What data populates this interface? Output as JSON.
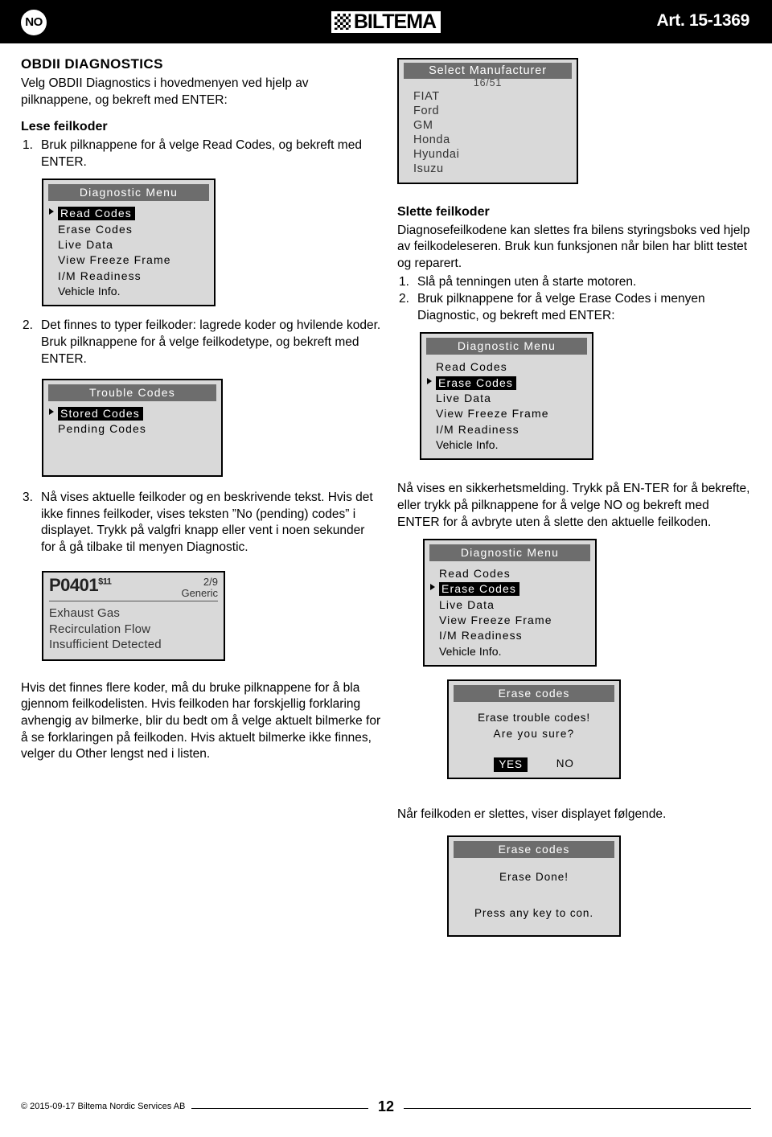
{
  "header": {
    "flag_label": "NO",
    "brand": "BILTEMA",
    "brand_icon": "checkerboard-icon",
    "art_no": "Art. 15-1369"
  },
  "left": {
    "section_title": "OBDII DIAGNOSTICS",
    "intro": "Velg OBDII Diagnostics i hovedmenyen ved hjelp av pilknappene, og bekreft med ENTER:",
    "sub_title": "Lese feilkoder",
    "step1": {
      "num": "1.",
      "text": "Bruk pilknappene for å velge Read Codes, og bekreft med ENTER."
    },
    "step2": {
      "num": "2.",
      "text": "Det finnes to typer feilkoder: lagrede koder og hvilende koder. Bruk pilknappene for å velge feilkodetype, og bekreft med ENTER."
    },
    "step3": {
      "num": "3.",
      "text": "Nå vises aktuelle feilkoder og en beskrivende tekst. Hvis det ikke finnes feilkoder, vises teksten ”No (pending) codes” i displayet. Trykk på valgfri knapp eller vent i noen sekunder for å gå tilbake til menyen Diagnostic."
    },
    "closing": "Hvis det finnes flere koder, må du bruke pilknappene for å bla gjennom feilkodelisten. Hvis feilkoden har forskjellig forklaring avhengig av bilmerke, blir du bedt om å velge aktuelt bilmerke for å se forklaringen på feilkoden. Hvis aktuelt bilmerke ikke finnes, velger du Other lengst ned i listen.",
    "diag_menu_1": {
      "title": "Diagnostic Menu",
      "items": [
        {
          "label": "Read Codes",
          "selected": true,
          "small": false
        },
        {
          "label": "Erase Codes",
          "selected": false,
          "small": false
        },
        {
          "label": "Live Data",
          "selected": false,
          "small": false
        },
        {
          "label": "View Freeze Frame",
          "selected": false,
          "small": false
        },
        {
          "label": "I/M Readiness",
          "selected": false,
          "small": false
        },
        {
          "label": "Vehicle Info.",
          "selected": false,
          "small": true
        }
      ]
    },
    "trouble_codes": {
      "title": "Trouble Codes",
      "items": [
        {
          "label": "Stored Codes",
          "selected": true,
          "small": false
        },
        {
          "label": "Pending Codes",
          "selected": false,
          "small": false
        }
      ]
    },
    "code_screen": {
      "code": "P0401",
      "code_sup": "$11",
      "index": "2/9",
      "type": "Generic",
      "desc_line1": "Exhaust Gas",
      "desc_line2": "Recirculation Flow",
      "desc_line3": "Insufficient Detected"
    }
  },
  "right": {
    "manufacturer_screen": {
      "title": "Select Manufacturer",
      "count": "16/51",
      "items": [
        {
          "label": "FIAT",
          "selected": false
        },
        {
          "label": "Ford",
          "selected": false
        },
        {
          "label": "GM",
          "selected": false
        },
        {
          "label": "Honda",
          "selected": true
        },
        {
          "label": "Hyundai",
          "selected": false
        },
        {
          "label": "Isuzu",
          "selected": false
        }
      ]
    },
    "sub_title": "Slette feilkoder",
    "intro": "Diagnosefeilkodene kan slettes fra bilens styringsboks ved hjelp av feilkodeleseren. Bruk kun funksjonen når bilen har blitt testet og reparert.",
    "step1": {
      "num": "1.",
      "text": "Slå på tenningen uten å starte motoren."
    },
    "step2": {
      "num": "2.",
      "text": "Bruk pilknappene for å velge Erase Codes i menyen Diagnostic, og bekreft med ENTER:"
    },
    "note": "Nå vises en sikkerhetsmelding. Trykk på EN-TER for å bekrefte, eller trykk på pilknappene for å velge NO og bekreft med ENTER for å avbryte uten å slette den aktuelle feilkoden.",
    "closing": "Når feilkoden er slettes, viser displayet følgende.",
    "diag_menu_2": {
      "title": "Diagnostic Menu",
      "items": [
        {
          "label": "Read Codes",
          "selected": false,
          "small": false
        },
        {
          "label": "Erase Codes",
          "selected": true,
          "small": false
        },
        {
          "label": "Live Data",
          "selected": false,
          "small": false
        },
        {
          "label": "View Freeze Frame",
          "selected": false,
          "small": false
        },
        {
          "label": "I/M Readiness",
          "selected": false,
          "small": false
        },
        {
          "label": "Vehicle Info.",
          "selected": false,
          "small": true
        }
      ]
    },
    "diag_menu_3": {
      "title": "Diagnostic Menu",
      "items": [
        {
          "label": "Read Codes",
          "selected": false,
          "small": false
        },
        {
          "label": "Erase Codes",
          "selected": true,
          "small": false
        },
        {
          "label": "Live Data",
          "selected": false,
          "small": false
        },
        {
          "label": "View Freeze Frame",
          "selected": false,
          "small": false
        },
        {
          "label": "I/M Readiness",
          "selected": false,
          "small": false
        },
        {
          "label": "Vehicle Info.",
          "selected": false,
          "small": true
        }
      ]
    },
    "erase_confirm": {
      "title": "Erase codes",
      "line1": "Erase trouble codes!",
      "line2": "Are you sure?",
      "yes": "YES",
      "no": "NO"
    },
    "erase_done": {
      "title": "Erase codes",
      "line1": "Erase Done!",
      "line2": "Press any key to con."
    }
  },
  "footer": {
    "copyright": "© 2015-09-17 Biltema Nordic Services AB",
    "page": "12"
  }
}
